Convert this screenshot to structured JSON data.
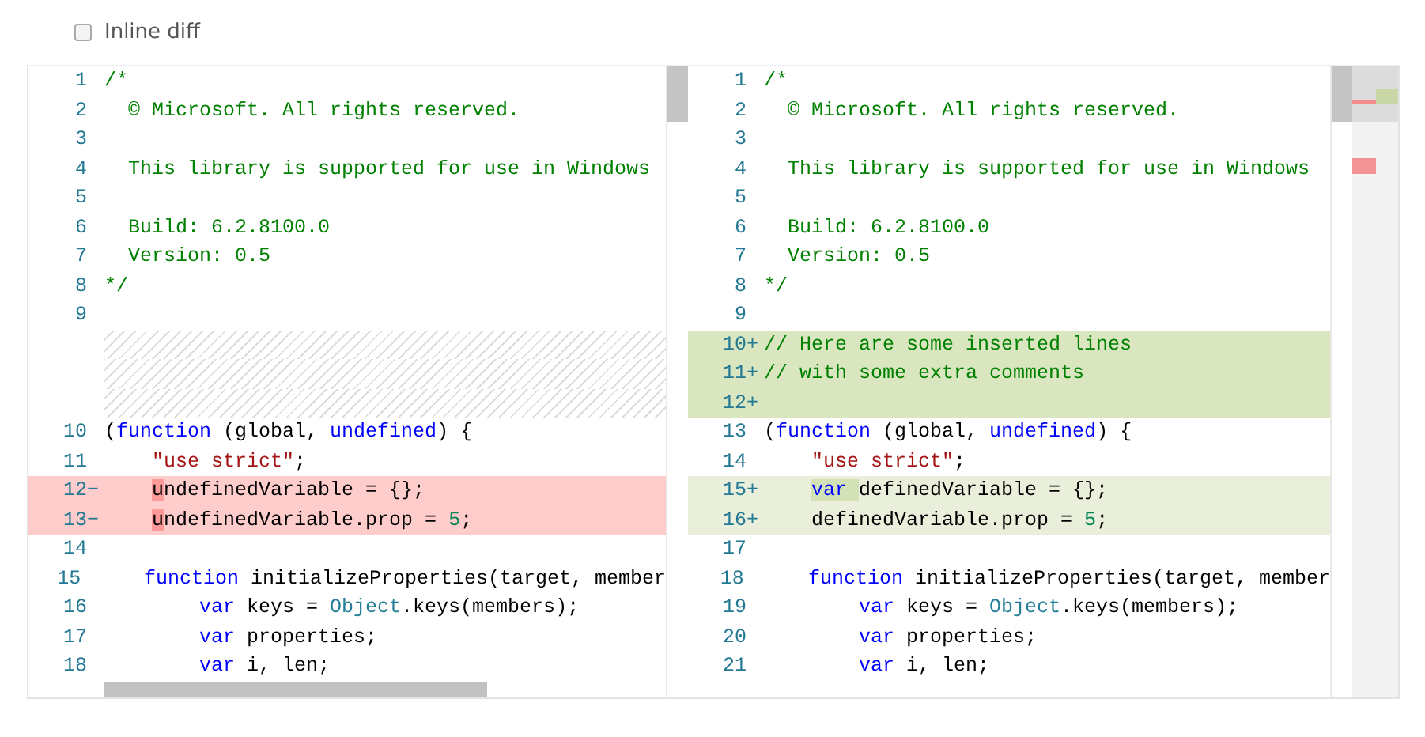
{
  "inline_diff": {
    "label": "Inline diff",
    "checked": false
  },
  "panes": [
    {
      "lines": [
        {
          "kind": "normal",
          "number": "1",
          "tokens": [
            {
              "text": "/*",
              "kind": "comment"
            }
          ]
        },
        {
          "kind": "normal",
          "number": "2",
          "tokens": [
            {
              "text": "  © Microsoft. All rights reserved.",
              "kind": "comment"
            }
          ]
        },
        {
          "kind": "normal",
          "number": "3"
        },
        {
          "kind": "normal",
          "number": "4",
          "tokens": [
            {
              "text": "  This library is supported for use in Windows",
              "kind": "comment"
            }
          ]
        },
        {
          "kind": "normal",
          "number": "5"
        },
        {
          "kind": "normal",
          "number": "6",
          "tokens": [
            {
              "text": "  Build: 6.2.8100.0",
              "kind": "comment"
            }
          ]
        },
        {
          "kind": "normal",
          "number": "7",
          "tokens": [
            {
              "text": "  Version: 0.5",
              "kind": "comment"
            }
          ]
        },
        {
          "kind": "normal",
          "number": "8",
          "tokens": [
            {
              "text": "*/",
              "kind": "comment"
            }
          ]
        },
        {
          "kind": "normal",
          "number": "9"
        },
        {
          "kind": "filler"
        },
        {
          "kind": "filler"
        },
        {
          "kind": "filler"
        },
        {
          "kind": "normal",
          "number": "10",
          "tokens": [
            {
              "text": "(",
              "kind": "plain"
            },
            {
              "text": "function",
              "kind": "keyword"
            },
            {
              "text": " (global, ",
              "kind": "plain"
            },
            {
              "text": "undefined",
              "kind": "keyword"
            },
            {
              "text": ") {",
              "kind": "plain"
            }
          ]
        },
        {
          "kind": "normal",
          "number": "11",
          "tokens": [
            {
              "text": "    \"use strict\"",
              "kind": "string"
            },
            {
              "text": ";",
              "kind": "plain"
            }
          ]
        },
        {
          "kind": "removed",
          "number": "12",
          "marker": "−",
          "tokens": [
            {
              "text": "    u",
              "kind": "deleted"
            },
            {
              "text": "ndefinedVariable = {};",
              "kind": "plain"
            }
          ]
        },
        {
          "kind": "removed",
          "number": "13",
          "marker": "−",
          "tokens": [
            {
              "text": "    u",
              "kind": "deleted"
            },
            {
              "text": "ndefinedVariable.prop = ",
              "kind": "plain"
            },
            {
              "text": "5",
              "kind": "number"
            },
            {
              "text": ";",
              "kind": "plain"
            }
          ]
        },
        {
          "kind": "normal",
          "number": "14"
        },
        {
          "kind": "normal",
          "number": "15",
          "tokens": [
            {
              "text": "    function",
              "kind": "keyword"
            },
            {
              "text": " initializeProperties(target, member",
              "kind": "plain"
            }
          ]
        },
        {
          "kind": "normal",
          "number": "16",
          "tokens": [
            {
              "text": "        var",
              "kind": "keyword"
            },
            {
              "text": " keys = ",
              "kind": "plain"
            },
            {
              "text": "Object",
              "kind": "type"
            },
            {
              "text": ".keys(members);",
              "kind": "plain"
            }
          ]
        },
        {
          "kind": "normal",
          "number": "17",
          "tokens": [
            {
              "text": "        var",
              "kind": "keyword"
            },
            {
              "text": " properties;",
              "kind": "plain"
            }
          ]
        },
        {
          "kind": "normal",
          "number": "18",
          "tokens": [
            {
              "text": "        var",
              "kind": "keyword"
            },
            {
              "text": " i, len;",
              "kind": "plain"
            }
          ]
        }
      ]
    },
    {
      "lines": [
        {
          "kind": "normal",
          "number": "1",
          "tokens": [
            {
              "text": "/*",
              "kind": "comment"
            }
          ]
        },
        {
          "kind": "normal",
          "number": "2",
          "tokens": [
            {
              "text": "  © Microsoft. All rights reserved.",
              "kind": "comment"
            }
          ]
        },
        {
          "kind": "normal",
          "number": "3"
        },
        {
          "kind": "normal",
          "number": "4",
          "tokens": [
            {
              "text": "  This library is supported for use in Windows",
              "kind": "comment"
            }
          ]
        },
        {
          "kind": "normal",
          "number": "5"
        },
        {
          "kind": "normal",
          "number": "6",
          "tokens": [
            {
              "text": "  Build: 6.2.8100.0",
              "kind": "comment"
            }
          ]
        },
        {
          "kind": "normal",
          "number": "7",
          "tokens": [
            {
              "text": "  Version: 0.5",
              "kind": "comment"
            }
          ]
        },
        {
          "kind": "normal",
          "number": "8",
          "tokens": [
            {
              "text": "*/",
              "kind": "comment"
            }
          ]
        },
        {
          "kind": "normal",
          "number": "9"
        },
        {
          "kind": "inserted",
          "number": "10",
          "marker": "+",
          "tokens": [
            {
              "text": "// Here are some inserted lines",
              "kind": "comment"
            }
          ]
        },
        {
          "kind": "inserted",
          "number": "11",
          "marker": "+",
          "tokens": [
            {
              "text": "// with some extra comments",
              "kind": "comment"
            }
          ]
        },
        {
          "kind": "inserted",
          "number": "12",
          "marker": "+"
        },
        {
          "kind": "normal",
          "number": "13",
          "tokens": [
            {
              "text": "(",
              "kind": "plain"
            },
            {
              "text": "function",
              "kind": "keyword"
            },
            {
              "text": " (global, ",
              "kind": "plain"
            },
            {
              "text": "undefined",
              "kind": "keyword"
            },
            {
              "text": ") {",
              "kind": "plain"
            }
          ]
        },
        {
          "kind": "normal",
          "number": "14",
          "tokens": [
            {
              "text": "    \"use strict\"",
              "kind": "string"
            },
            {
              "text": ";",
              "kind": "plain"
            }
          ]
        },
        {
          "kind": "added",
          "number": "15",
          "marker": "+",
          "tokens": [
            {
              "text": "    var ",
              "kind": "inserted_keyword"
            },
            {
              "text": "definedVariable = {};",
              "kind": "plain"
            }
          ]
        },
        {
          "kind": "added",
          "number": "16",
          "marker": "+",
          "tokens": [
            {
              "text": "    definedVariable.prop = ",
              "kind": "plain"
            },
            {
              "text": "5",
              "kind": "number"
            },
            {
              "text": ";",
              "kind": "plain"
            }
          ]
        },
        {
          "kind": "normal",
          "number": "17"
        },
        {
          "kind": "normal",
          "number": "18",
          "tokens": [
            {
              "text": "    function",
              "kind": "keyword"
            },
            {
              "text": " initializeProperties(target, member",
              "kind": "plain"
            }
          ]
        },
        {
          "kind": "normal",
          "number": "19",
          "tokens": [
            {
              "text": "        var",
              "kind": "keyword"
            },
            {
              "text": " keys = ",
              "kind": "plain"
            },
            {
              "text": "Object",
              "kind": "type"
            },
            {
              "text": ".keys(members);",
              "kind": "plain"
            }
          ]
        },
        {
          "kind": "normal",
          "number": "20",
          "tokens": [
            {
              "text": "        var",
              "kind": "keyword"
            },
            {
              "text": " properties;",
              "kind": "plain"
            }
          ]
        },
        {
          "kind": "normal",
          "number": "21",
          "tokens": [
            {
              "text": "        var",
              "kind": "keyword"
            },
            {
              "text": " i, len;",
              "kind": "plain"
            }
          ]
        }
      ]
    }
  ]
}
